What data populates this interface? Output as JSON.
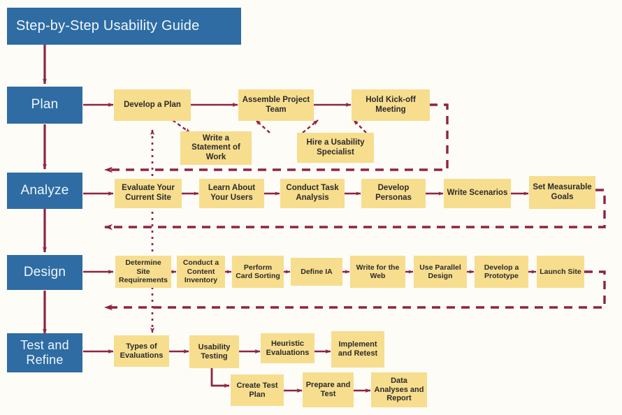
{
  "header": {
    "title": "Step-by-Step Usability Guide"
  },
  "colors": {
    "phase_blue": "#2e6ca3",
    "task_yellow": "#f7dd8e",
    "connector_maroon": "#8e2346",
    "background": "#fdfcf7",
    "text_dark": "#2b2b2b",
    "text_light": "#f0f6fb"
  },
  "phases": [
    {
      "id": "plan",
      "label": "Plan"
    },
    {
      "id": "analyze",
      "label": "Analyze"
    },
    {
      "id": "design",
      "label": "Design"
    },
    {
      "id": "test",
      "label": "Test and Refine"
    }
  ],
  "rows": {
    "plan": {
      "label": "Plan",
      "main": [
        "Develop a Plan",
        "Assemble Project Team",
        "Hold Kick-off Meeting"
      ],
      "sub": [
        "Write a Statement of Work",
        "Hire a Usability Specialist"
      ]
    },
    "analyze": {
      "label": "Analyze",
      "main": [
        "Evaluate Your Current Site",
        "Learn About Your Users",
        "Conduct Task Analysis",
        "Develop Personas",
        "Write Scenarios",
        "Set Measurable Goals"
      ]
    },
    "design": {
      "label": "Design",
      "main": [
        "Determine Site Requirements",
        "Conduct a Content Inventory",
        "Perform Card Sorting",
        "Define IA",
        "Write for the Web",
        "Use Parallel Design",
        "Develop a Prototype",
        "Launch Site"
      ]
    },
    "test": {
      "label": "Test and Refine",
      "main": [
        "Types of Evaluations",
        "Usability Testing",
        "Heuristic Evaluations",
        "Implement and Retest"
      ],
      "sub": [
        "Create Test Plan",
        "Prepare and Test",
        "Data Analyses and Report"
      ]
    }
  }
}
